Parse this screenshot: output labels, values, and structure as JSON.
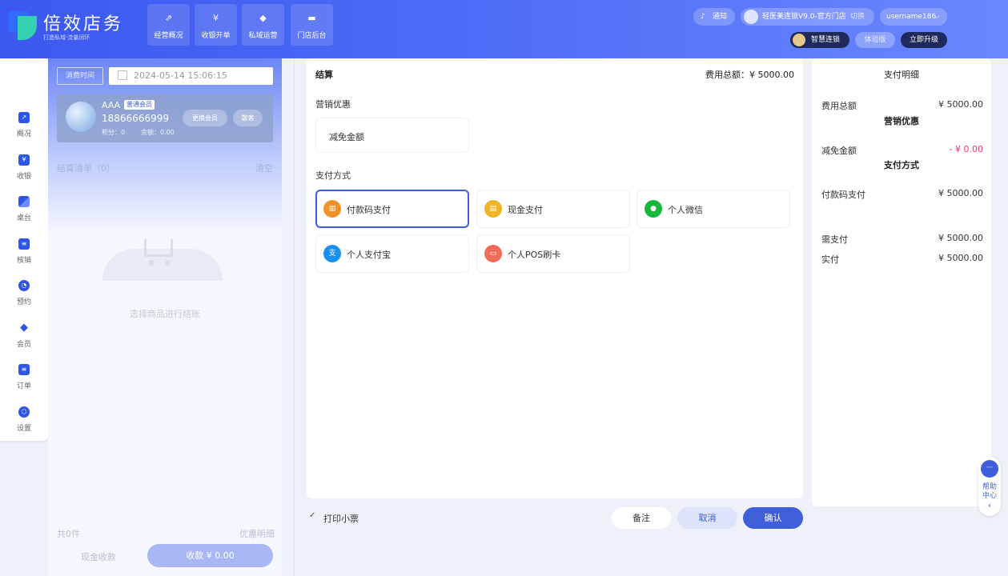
{
  "brand": {
    "title": "倍效店务",
    "subtitle": "打造私域·流量闭环"
  },
  "nav": [
    {
      "label": "经营概况",
      "icon": "trend-icon"
    },
    {
      "label": "收银开单",
      "icon": "cashier-icon"
    },
    {
      "label": "私域运营",
      "icon": "diamond-icon"
    },
    {
      "label": "门店后台",
      "icon": "store-icon"
    }
  ],
  "header": {
    "notice": "通知",
    "store": "轻医美连锁V9.0-官方门店",
    "switch": "切换",
    "username": "username186",
    "plan": "智慧连锁",
    "trial": "体验版",
    "upgrade": "立即升级"
  },
  "sidebar": [
    {
      "label": "概况",
      "icon": "chart-icon",
      "glyph": "↗"
    },
    {
      "label": "收银",
      "icon": "yen-icon",
      "glyph": "¥"
    },
    {
      "label": "桌台",
      "icon": "table-icon",
      "glyph": ""
    },
    {
      "label": "核销",
      "icon": "verify-icon",
      "glyph": "≡"
    },
    {
      "label": "预约",
      "icon": "clock-icon",
      "glyph": "◔"
    },
    {
      "label": "会员",
      "icon": "gem-icon",
      "glyph": "◆"
    },
    {
      "label": "订单",
      "icon": "order-icon",
      "glyph": "≡"
    },
    {
      "label": "设置",
      "icon": "settings-icon",
      "glyph": "⬡"
    }
  ],
  "left": {
    "time_label": "消费时间",
    "time_value": "2024-05-14 15:06:15",
    "member_name": "AAA",
    "member_level": "普通会员",
    "member_phone": "18866666999",
    "member_points": "积分：0",
    "member_balance": "余额：0.00",
    "change_member": "更换会员",
    "walk_in": "散客",
    "list_title": "结算清单（0）",
    "clear": "清空",
    "empty_text": "选择商品进行结账",
    "total_count": "共0件",
    "discount_detail": "优惠明细",
    "cash_collect": "现金收款",
    "collect_button": "收款 ¥ 0.00"
  },
  "settlement": {
    "title": "结算",
    "total_label": "费用总额：",
    "total_value": "¥ 5000.00",
    "promo_title": "营销优惠",
    "promo_option": "减免金额",
    "pay_title": "支付方式",
    "methods": [
      {
        "label": "付款码支付",
        "icon": "qr-pay-icon",
        "color": "#f0922b"
      },
      {
        "label": "现金支付",
        "icon": "cash-icon",
        "color": "#f0b429"
      },
      {
        "label": "个人微信",
        "icon": "wechat-icon",
        "color": "#17b83d"
      },
      {
        "label": "个人支付宝",
        "icon": "alipay-icon",
        "color": "#1a8ff0"
      },
      {
        "label": "个人POS刷卡",
        "icon": "pos-card-icon",
        "color": "#f06b5a"
      }
    ]
  },
  "footer": {
    "print_receipt": "打印小票",
    "remark": "备注",
    "cancel": "取消",
    "confirm": "确认"
  },
  "detail": {
    "title": "支付明细",
    "fee_total_label": "费用总额",
    "fee_total_value": "¥ 5000.00",
    "promo_section": "营销优惠",
    "reduce_label": "减免金额",
    "reduce_value": "- ¥ 0.00",
    "pay_section": "支付方式",
    "qr_label": "付款码支付",
    "qr_value": "¥ 5000.00",
    "need_label": "需支付",
    "need_value": "¥ 5000.00",
    "paid_label": "实付",
    "paid_value": "¥ 5000.00"
  },
  "help": {
    "line1": "帮助",
    "line2": "中心"
  },
  "colors": {
    "primary": "#3f5ed9",
    "accent_red": "#f0356b",
    "bg": "#eef1f7"
  }
}
